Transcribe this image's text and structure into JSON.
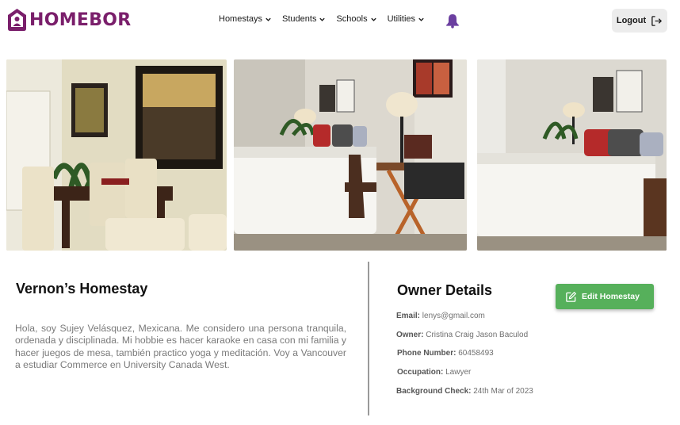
{
  "brand": {
    "logo_text": "HOMEBOR",
    "color": "#7a1f6b"
  },
  "nav": {
    "items": [
      {
        "label": "Homestays"
      },
      {
        "label": "Students"
      },
      {
        "label": "Schools"
      },
      {
        "label": "Utilities"
      }
    ],
    "bell_icon": "bell-icon",
    "bell_color": "#6b3fa0"
  },
  "header": {
    "logout_label": "Logout",
    "logout_icon": "logout-icon"
  },
  "photos": [
    {
      "name": "dining-room-photo"
    },
    {
      "name": "bedroom-desk-photo"
    },
    {
      "name": "bedroom-photo"
    }
  ],
  "homestay": {
    "title": "Vernon’s Homestay",
    "description": "Hola, soy Sujey Velásquez, Mexicana. Me considero una persona tranquila, ordenada y disciplinada. Mi hobbie es hacer karaoke en casa con mi familia y hacer juegos de mesa, también practico yoga y meditación. Voy a Vancouver a estudiar Commerce en University Canada West."
  },
  "owner": {
    "title": "Owner Details",
    "edit_label": "Edit Homestay",
    "edit_icon": "edit-icon",
    "edit_color": "#56b05b",
    "details": [
      {
        "label": "Email:",
        "value": "lenys@gmail.com"
      },
      {
        "label": "Owner:",
        "value": "Cristina Craig Jason Baculod"
      },
      {
        "label": "Phone Number:",
        "value": "60458493"
      },
      {
        "label": "Occupation:",
        "value": "Lawyer"
      },
      {
        "label": "Background Check:",
        "value": "24th Mar of 2023"
      }
    ]
  }
}
